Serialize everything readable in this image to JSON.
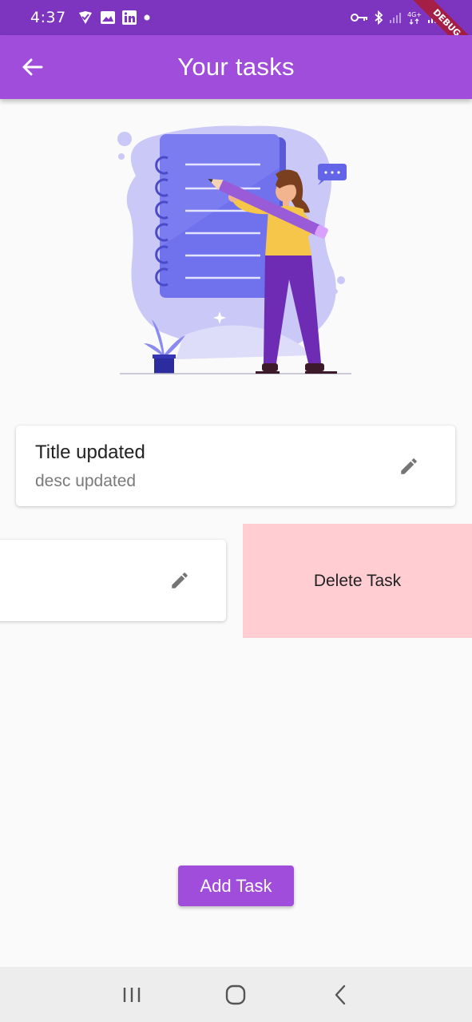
{
  "status_bar": {
    "time": "4:37",
    "left_icons": [
      "verified-check-icon",
      "image-icon",
      "linkedin-icon",
      "dot-icon"
    ],
    "right_icons": [
      "key-icon",
      "bluetooth-icon",
      "signal-icon",
      "network-4g-icon",
      "signal-icon-2"
    ],
    "network_label": "4G+",
    "debug_label": "DEBUG"
  },
  "app_bar": {
    "title": "Your tasks",
    "background": "#a04ddc"
  },
  "tasks": [
    {
      "title": "Title updated",
      "description": "desc updated"
    },
    {
      "title": "",
      "description": ""
    }
  ],
  "swipe_action": {
    "label": "Delete Task",
    "background": "#ffcdd2"
  },
  "add_button": {
    "label": "Add Task",
    "background": "#a04ddc"
  },
  "colors": {
    "status_bar": "#7d35bf",
    "accent": "#a04ddc",
    "page_background": "#fafafa",
    "nav_bar": "#ededed"
  }
}
